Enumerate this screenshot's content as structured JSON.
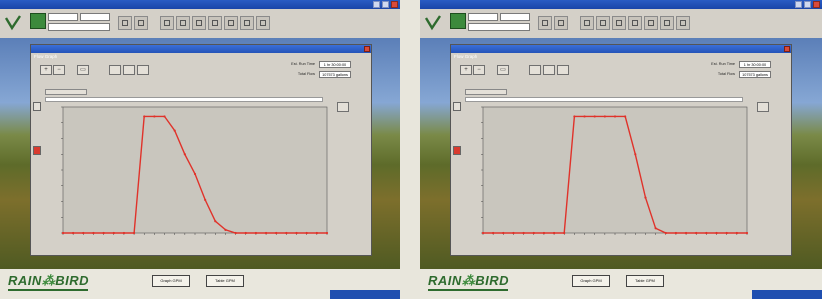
{
  "panels": [
    {
      "window_title": "Flow Graph",
      "info": [
        {
          "label": "Est. Run Time",
          "value": "1 hr 30:00:00"
        },
        {
          "label": "Total Flow",
          "value": "107573 gallons"
        }
      ],
      "bottom_buttons": [
        {
          "label": "Graph GPM"
        },
        {
          "label": "Table GPM"
        }
      ],
      "chart_data": {
        "type": "line",
        "series": [
          {
            "x": [
              0,
              10,
              20,
              30,
              40,
              50,
              60,
              70,
              80,
              90,
              100,
              110,
              120,
              130,
              140,
              150,
              160,
              170,
              180,
              190,
              200,
              210,
              220,
              230,
              240,
              250,
              260
            ],
            "y": [
              0,
              0,
              0,
              0,
              0,
              0,
              0,
              0,
              1480,
              1480,
              1480,
              1300,
              1000,
              750,
              420,
              150,
              40,
              0,
              0,
              0,
              0,
              0,
              0,
              0,
              0,
              0,
              0
            ]
          }
        ],
        "xlim": [
          0,
          260
        ],
        "ylim": [
          0,
          1600
        ],
        "color": "#e0322a"
      }
    },
    {
      "window_title": "Flow Graph",
      "info": [
        {
          "label": "Est. Run Time",
          "value": "1 hr 30:00:00"
        },
        {
          "label": "Total Flow",
          "value": "107573 gallons"
        }
      ],
      "bottom_buttons": [
        {
          "label": "Graph GPM"
        },
        {
          "label": "Table GPM"
        }
      ],
      "chart_data": {
        "type": "line",
        "series": [
          {
            "x": [
              0,
              10,
              20,
              30,
              40,
              50,
              60,
              70,
              80,
              90,
              100,
              110,
              120,
              130,
              140,
              150,
              160,
              170,
              180,
              190,
              200,
              210,
              220,
              230,
              240,
              250,
              260
            ],
            "y": [
              0,
              0,
              0,
              0,
              0,
              0,
              0,
              0,
              0,
              1480,
              1480,
              1480,
              1480,
              1480,
              1480,
              1000,
              450,
              60,
              0,
              0,
              0,
              0,
              0,
              0,
              0,
              0,
              0
            ]
          }
        ],
        "xlim": [
          0,
          260
        ],
        "ylim": [
          0,
          1600
        ],
        "color": "#e0322a"
      }
    }
  ],
  "brand": {
    "pre": "RAIN",
    "post": "BIRD"
  },
  "colors": {
    "line": "#e0322a",
    "plot_bg": "#c9c6be",
    "window": "#d4d0c8",
    "brand": "#2e6b2e"
  }
}
